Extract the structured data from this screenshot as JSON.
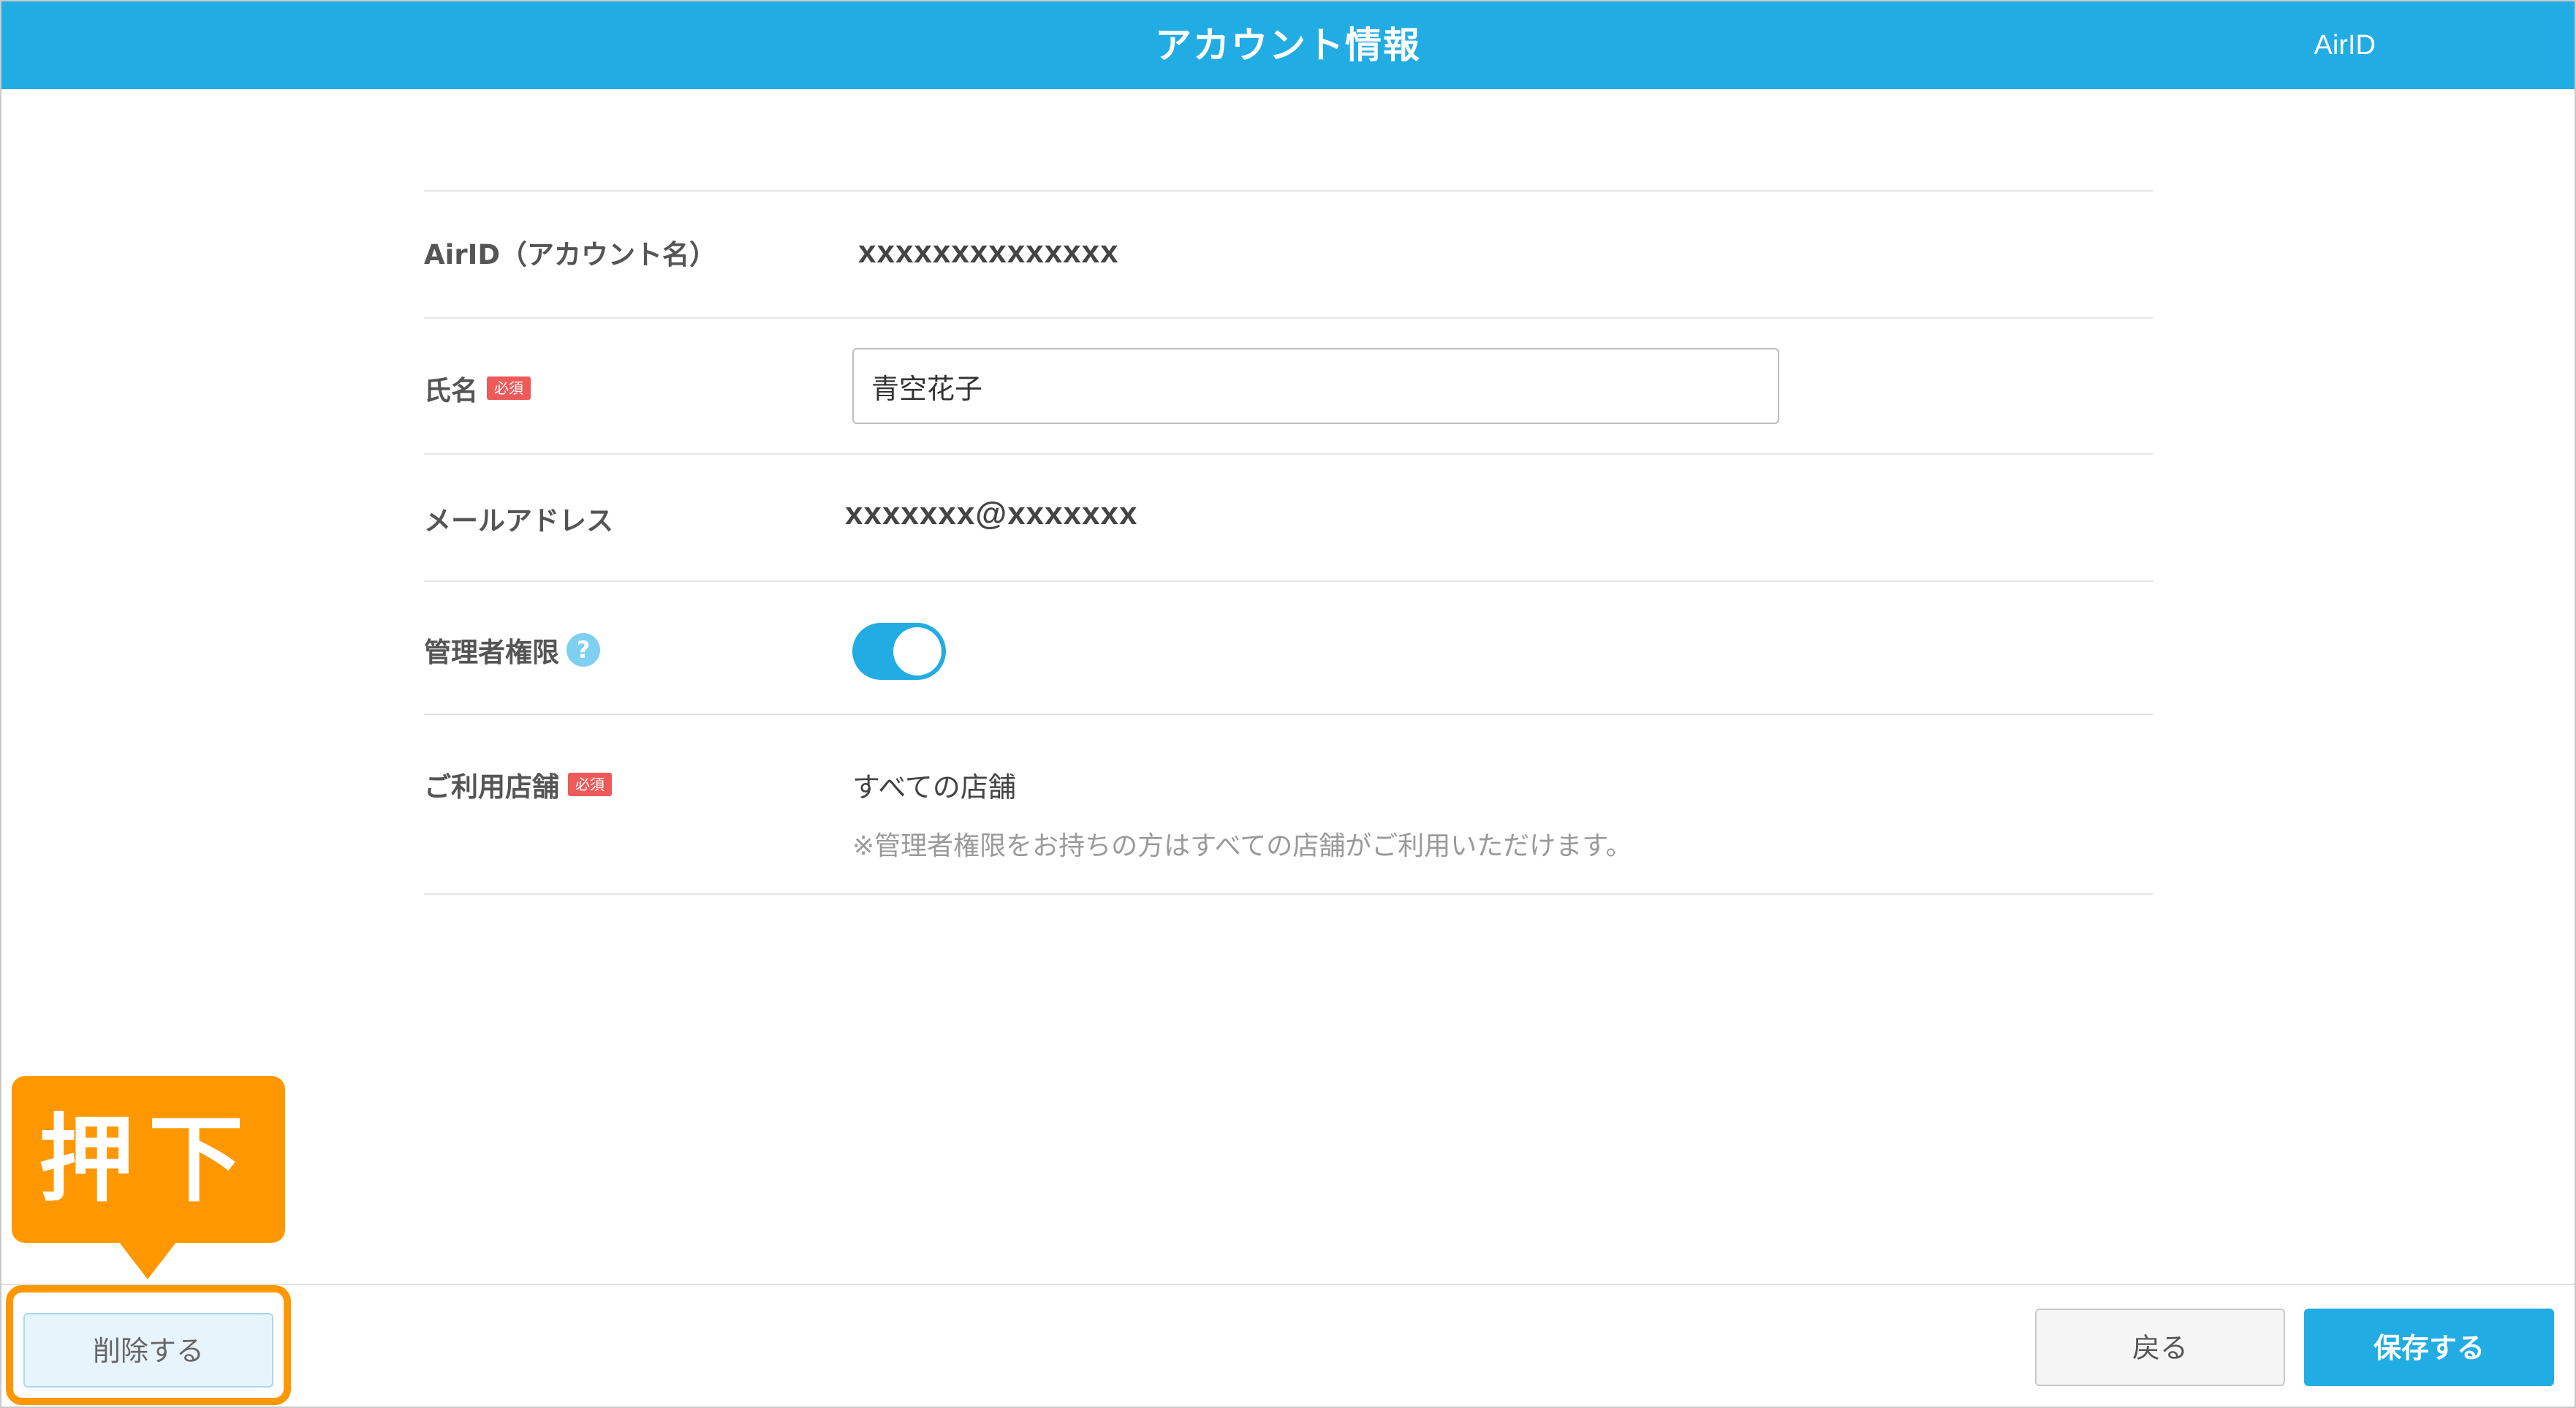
{
  "header": {
    "title": "アカウント情報",
    "brand": "AirID"
  },
  "form": {
    "airid": {
      "label": "AirID（アカウント名）",
      "value": "xxxxxxxxxxxxxx"
    },
    "name": {
      "label": "氏名",
      "required_badge": "必須",
      "value": "青空花子"
    },
    "email": {
      "label": "メールアドレス",
      "value": "xxxxxxx@xxxxxxx"
    },
    "admin": {
      "label": "管理者権限",
      "help_glyph": "?",
      "toggle_on": true
    },
    "stores": {
      "label": "ご利用店舗",
      "required_badge": "必須",
      "value": "すべての店舗",
      "note": "※管理者権限をお持ちの方はすべての店舗がご利用いただけます。"
    }
  },
  "footer": {
    "delete_label": "削除する",
    "back_label": "戻る",
    "save_label": "保存する"
  },
  "annotation": {
    "callout_text": "押下",
    "color": "#ff9800"
  },
  "colors": {
    "accent": "#22ace4",
    "required": "#ee5a5a",
    "callout": "#ff9800"
  }
}
